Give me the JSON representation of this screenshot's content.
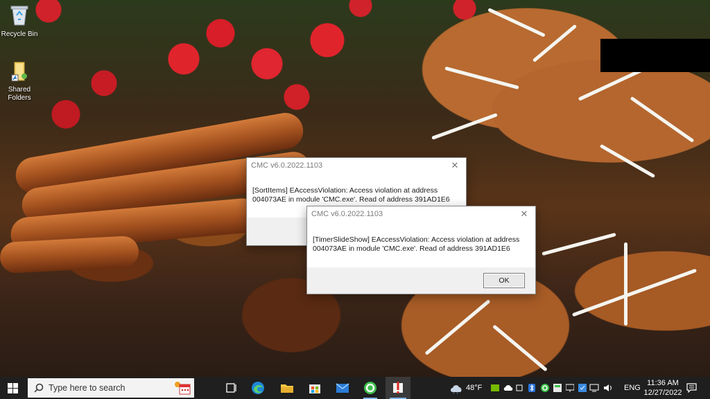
{
  "desktop": {
    "icons": [
      {
        "label": "Recycle Bin",
        "icon": "recycle-bin-icon"
      },
      {
        "label": "Shared Folders",
        "icon": "folder-icon"
      }
    ]
  },
  "dialogs": [
    {
      "title": "CMC v6.0.2022.1103",
      "message": "[SortItems] EAccessViolation: Access violation at address 004073AE in module 'CMC.exe'. Read of address 391AD1E6"
    },
    {
      "title": "CMC v6.0.2022.1103",
      "message": "[TimerSlideShow] EAccessViolation: Access violation at address 004073AE in module 'CMC.exe'. Read of address 391AD1E6",
      "ok_label": "OK"
    }
  ],
  "taskbar": {
    "search_placeholder": "Type here to search",
    "pinned_apps": [
      "task-view-icon",
      "edge-icon",
      "file-explorer-icon",
      "store-icon",
      "mail-icon",
      "cmc-app-icon",
      "app-alert-icon"
    ],
    "weather": {
      "temperature": "48°F",
      "icon": "weather-cloud-icon"
    },
    "language": "ENG",
    "time": "11:36 AM",
    "date": "12/27/2022",
    "tray_icons": [
      "nvidia-icon",
      "cloud-icon",
      "bluetooth-icon",
      "app-green-icon",
      "app-tray-icon",
      "display-icon",
      "security-icon",
      "network-icon",
      "speaker-icon"
    ]
  },
  "colors": {
    "taskbar": "#1f1f1f",
    "dialog_footer": "#f0f0f0",
    "accent": "#7fb3e8"
  }
}
